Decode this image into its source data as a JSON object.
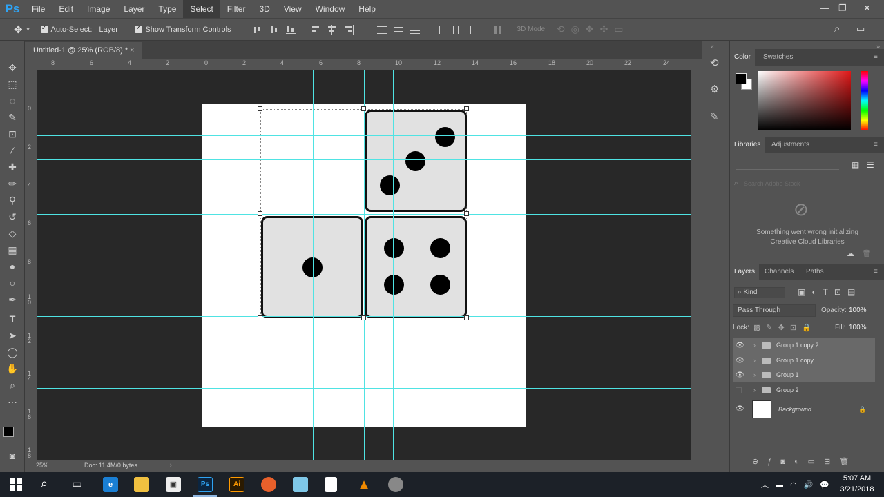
{
  "app": {
    "logo": "Ps"
  },
  "menu": [
    "File",
    "Edit",
    "Image",
    "Layer",
    "Type",
    "Select",
    "Filter",
    "3D",
    "View",
    "Window",
    "Help"
  ],
  "options": {
    "auto_select": "Auto-Select:",
    "auto_select_target": "Layer",
    "show_transform": "Show Transform Controls",
    "mode_3d": "3D Mode:"
  },
  "document": {
    "tab_title": "Untitled-1 @ 25% (RGB/8) *"
  },
  "ruler": {
    "top": [
      "8",
      "6",
      "4",
      "2",
      "0",
      "2",
      "4",
      "6",
      "8",
      "10",
      "12",
      "14",
      "16",
      "18",
      "20",
      "22",
      "24"
    ],
    "left": [
      "0",
      "2",
      "4",
      "6",
      "8",
      "1\n0",
      "1\n2",
      "1\n4",
      "1\n6",
      "1\n8"
    ]
  },
  "status": {
    "zoom": "25%",
    "doc": "Doc: 11.4M/0 bytes"
  },
  "panels": {
    "color_tabs": [
      "Color",
      "Swatches"
    ],
    "lib_tabs": [
      "Libraries",
      "Adjustments"
    ],
    "lib_search": "Search Adobe Stock",
    "lib_error": "Something went wrong initializing Creative Cloud Libraries",
    "layer_tabs": [
      "Layers",
      "Channels",
      "Paths"
    ],
    "kind": "Kind",
    "blend": "Pass Through",
    "opacity_label": "Opacity:",
    "opacity": "100%",
    "lock_label": "Lock:",
    "fill_label": "Fill:",
    "fill": "100%",
    "layers": [
      "Group 1 copy 2",
      "Group 1 copy",
      "Group 1",
      "Group 2",
      "Background"
    ]
  },
  "taskbar": {
    "time": "5:07 AM",
    "date": "3/21/2018"
  },
  "colors": {
    "guide": "#4fe3e3",
    "ps_blue": "#2fa3f3"
  }
}
